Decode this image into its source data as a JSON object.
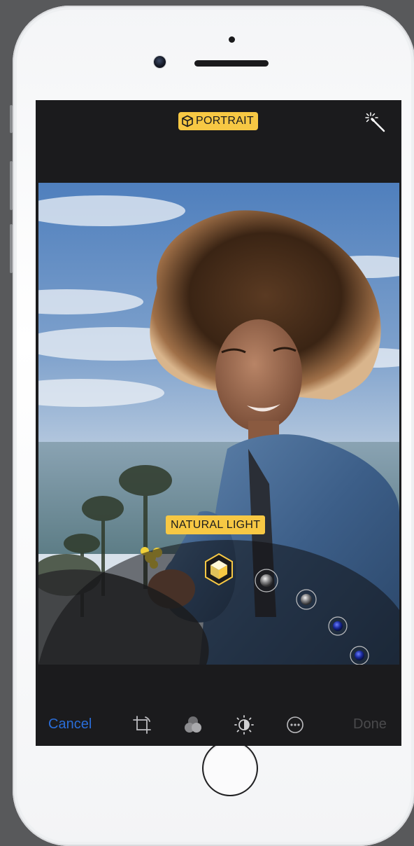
{
  "header": {
    "mode_badge": "PORTRAIT",
    "auto_enhance_icon": "magic-wand-icon"
  },
  "photo": {
    "lighting_label": "NATURAL LIGHT",
    "lighting_options": [
      "Natural Light",
      "Studio Light",
      "Contour Light",
      "Stage Light",
      "Stage Light Mono"
    ],
    "selected_lighting_index": 0
  },
  "toolbar": {
    "cancel_label": "Cancel",
    "done_label": "Done",
    "tools": [
      "crop-icon",
      "filters-icon",
      "adjust-icon",
      "more-icon"
    ]
  },
  "colors": {
    "badge": "#f7c844",
    "cancel": "#2a6dd8",
    "done_disabled": "#4a4a4c",
    "screen_bg": "#1b1b1d"
  }
}
